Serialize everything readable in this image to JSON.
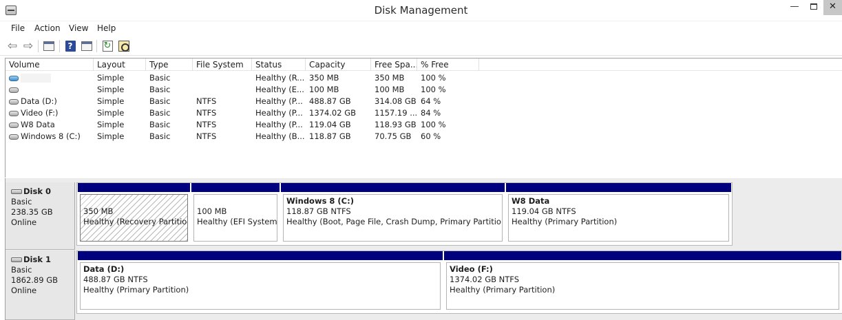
{
  "window": {
    "title": "Disk Management",
    "min_glyph": "—",
    "close_glyph": "✕"
  },
  "menu": [
    "File",
    "Action",
    "View",
    "Help"
  ],
  "toolbar": {
    "icons": [
      "back-arrow-icon",
      "forward-arrow-icon",
      "console-tree-icon",
      "help-icon",
      "show-pane-icon",
      "refresh-icon",
      "properties-icon"
    ],
    "back_glyph": "⇦",
    "forward_glyph": "⇨",
    "help_glyph": "?",
    "refresh_glyph": "↻"
  },
  "volume_list": {
    "columns": [
      "Volume",
      "Layout",
      "Type",
      "File System",
      "Status",
      "Capacity",
      "Free Spa...",
      "% Free"
    ],
    "rows": [
      {
        "volume": "",
        "icon": "recovery-volume-icon",
        "layout": "Simple",
        "type": "Basic",
        "fs": "",
        "status": "Healthy (R...",
        "capacity": "350 MB",
        "free": "350 MB",
        "pct": "100 %"
      },
      {
        "volume": "",
        "icon": "volume-icon",
        "layout": "Simple",
        "type": "Basic",
        "fs": "",
        "status": "Healthy (E...",
        "capacity": "100 MB",
        "free": "100 MB",
        "pct": "100 %"
      },
      {
        "volume": "Data (D:)",
        "icon": "volume-icon",
        "layout": "Simple",
        "type": "Basic",
        "fs": "NTFS",
        "status": "Healthy (P...",
        "capacity": "488.87 GB",
        "free": "314.08 GB",
        "pct": "64 %"
      },
      {
        "volume": "Video (F:)",
        "icon": "volume-icon",
        "layout": "Simple",
        "type": "Basic",
        "fs": "NTFS",
        "status": "Healthy (P...",
        "capacity": "1374.02 GB",
        "free": "1157.19 ...",
        "pct": "84 %"
      },
      {
        "volume": "W8 Data",
        "icon": "volume-icon",
        "layout": "Simple",
        "type": "Basic",
        "fs": "NTFS",
        "status": "Healthy (P...",
        "capacity": "119.04 GB",
        "free": "118.93 GB",
        "pct": "100 %"
      },
      {
        "volume": "Windows 8 (C:)",
        "icon": "volume-icon",
        "layout": "Simple",
        "type": "Basic",
        "fs": "NTFS",
        "status": "Healthy (B...",
        "capacity": "118.87 GB",
        "free": "70.75 GB",
        "pct": "60 %"
      }
    ]
  },
  "disks": [
    {
      "name": "Disk 0",
      "type": "Basic",
      "size": "238.35 GB",
      "status": "Online",
      "partitions": [
        {
          "name": "",
          "size": "350 MB",
          "status": "Healthy (Recovery Partition)"
        },
        {
          "name": "",
          "size": "100 MB",
          "status": "Healthy (EFI System P"
        },
        {
          "name": "Windows 8  (C:)",
          "size": "118.87 GB NTFS",
          "status": "Healthy (Boot, Page File, Crash Dump, Primary Partition)"
        },
        {
          "name": "W8 Data",
          "size": "119.04 GB NTFS",
          "status": "Healthy (Primary Partition)"
        }
      ]
    },
    {
      "name": "Disk 1",
      "type": "Basic",
      "size": "1862.89 GB",
      "status": "Online",
      "partitions": [
        {
          "name": "Data  (D:)",
          "size": "488.87 GB NTFS",
          "status": "Healthy (Primary Partition)"
        },
        {
          "name": "Video  (F:)",
          "size": "1374.02 GB NTFS",
          "status": "Healthy (Primary Partition)"
        }
      ]
    }
  ],
  "colors": {
    "partition_bar": "#00007f",
    "pane_bg": "#ececec"
  }
}
